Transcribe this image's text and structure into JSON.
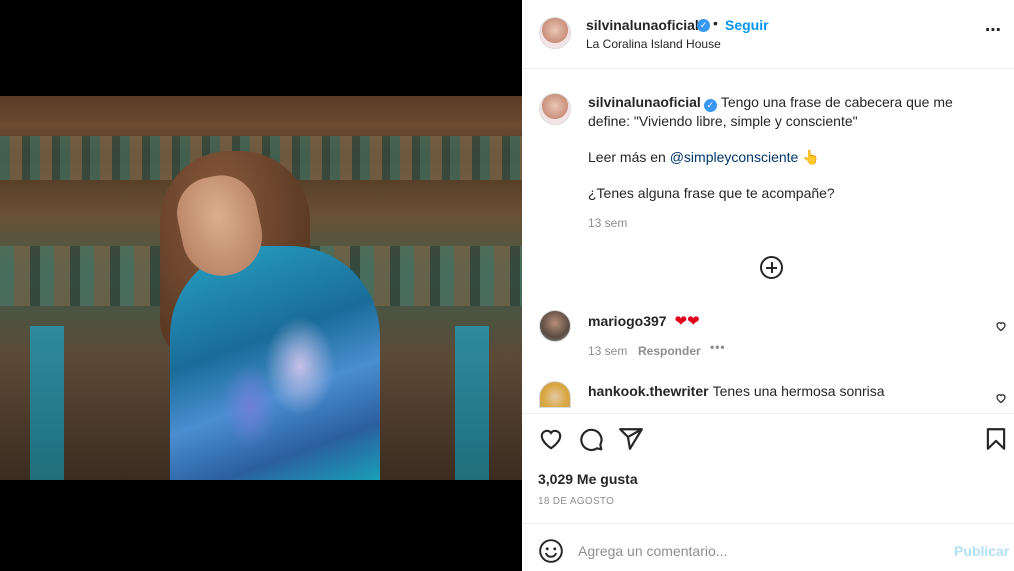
{
  "post": {
    "username": "silvinalunaoficial",
    "follow_label": "Seguir",
    "separator": "•",
    "location": "La Coralina Island House",
    "more_icon": "⋯"
  },
  "caption": {
    "username": "silvinalunaoficial",
    "line1": "Tengo una frase de cabecera que me define: \"Viviendo libre, simple y consciente\"",
    "read_more_prefix": "Leer más en ",
    "mention": "@simpleyconsciente",
    "pointing_emoji": "👆",
    "question": "¿Tenes alguna frase que te acompañe?",
    "time": "13 sem"
  },
  "comments": [
    {
      "username": "mariogo397",
      "text_emoji": "❤❤",
      "time": "13 sem",
      "reply_label": "Responder",
      "more": "•••"
    },
    {
      "username": "hankook.thewriter",
      "text": "Tenes una hermosa sonrisa"
    }
  ],
  "stats": {
    "likes": "3,029 Me gusta",
    "date": "18 DE AGOSTO"
  },
  "add_comment": {
    "placeholder": "Agrega un comentario...",
    "publish_label": "Publicar"
  },
  "icons": {
    "verified": "verified-badge-icon",
    "like": "heart-icon",
    "comment": "comment-icon",
    "share": "send-icon",
    "save": "bookmark-icon",
    "emoji": "smiley-icon",
    "load_more": "plus-circle-icon"
  },
  "colors": {
    "link_blue": "#0095f6",
    "verified_blue": "#3897f0",
    "publish_disabled": "#b2dffc",
    "muted": "#8e8e8e"
  }
}
